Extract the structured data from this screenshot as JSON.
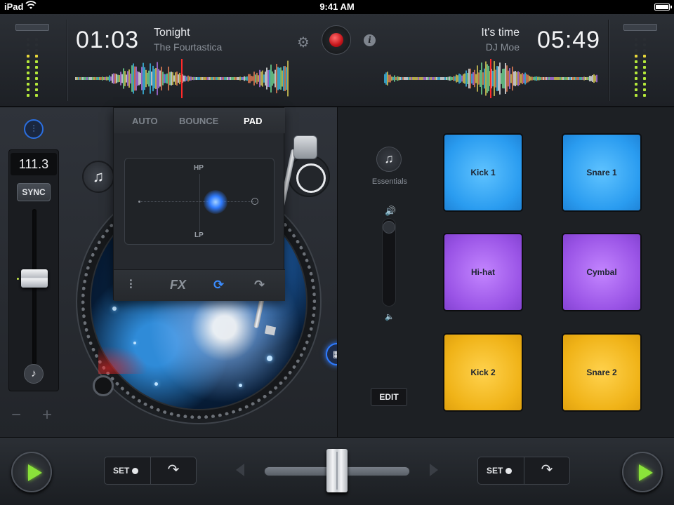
{
  "status_bar": {
    "carrier": "iPad",
    "time": "9:41 AM"
  },
  "deck_left": {
    "elapsed": "01:03",
    "track_title": "Tonight",
    "track_artist": "The Fourtastica",
    "bpm": "111.3",
    "sync_label": "SYNC",
    "minus_label": "−",
    "plus_label": "+"
  },
  "deck_right": {
    "remaining": "05:49",
    "track_title": "It's time",
    "track_artist": "DJ Moe"
  },
  "fx_panel": {
    "tabs": [
      {
        "label": "AUTO",
        "active": false
      },
      {
        "label": "BOUNCE",
        "active": false
      },
      {
        "label": "PAD",
        "active": true
      }
    ],
    "xy_top_label": "HP",
    "xy_bottom_label": "LP",
    "bottom_icons": [
      "mixer-icon",
      "fx-icon",
      "loop-icon",
      "jump-icon"
    ],
    "fx_label": "FX"
  },
  "sampler": {
    "library_label": "Essentials",
    "edit_label": "EDIT",
    "pads": [
      {
        "label": "Kick 1",
        "color": "blue"
      },
      {
        "label": "Snare 1",
        "color": "blue"
      },
      {
        "label": "Hi-hat",
        "color": "purple"
      },
      {
        "label": "Cymbal",
        "color": "purple"
      },
      {
        "label": "Kick 2",
        "color": "yellow"
      },
      {
        "label": "Snare 2",
        "color": "yellow"
      }
    ]
  },
  "transport": {
    "left_set_label": "SET",
    "right_set_label": "SET",
    "crossfader_position": 0.5
  },
  "colors": {
    "accent_blue": "#2f7bff",
    "record_red": "#c4141a",
    "play_green": "#8ae23a",
    "pad_blue": "#2a9cf0",
    "pad_purple": "#9a54e6",
    "pad_yellow": "#f0b318"
  }
}
